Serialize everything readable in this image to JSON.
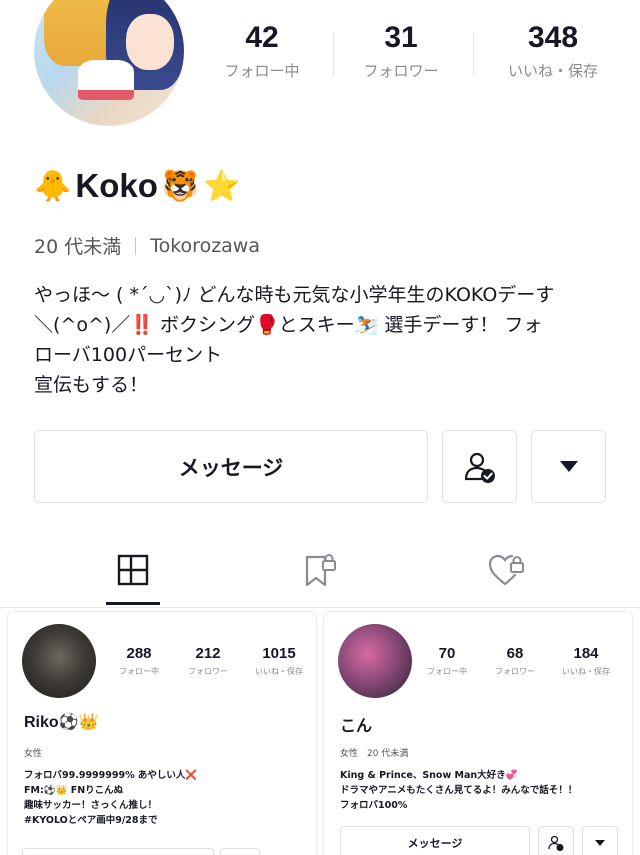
{
  "profile": {
    "avatar_icon": "profile-avatar-anime-artwork",
    "name": "Koko",
    "name_emoji_before": "🐥",
    "name_emoji_after_1": "🐯",
    "name_emoji_after_2": "⭐",
    "age": "20 代未満",
    "location": "Tokorozawa",
    "bio": [
      "やっほ〜 ( *´◡`)ﾉ どんな時も元気な小学年生のKOKOデーす",
      "＼(^o^)／‼️ ボクシング🥊とスキー⛷️ 選手デーす！ フォ",
      "ローバ100パーセント",
      "宣伝もする！"
    ]
  },
  "stats": [
    {
      "value": "42",
      "label": "フォロー中"
    },
    {
      "value": "31",
      "label": "フォロワー"
    },
    {
      "value": "348",
      "label": "いいね・保存"
    }
  ],
  "actions": {
    "message_label": "メッセージ",
    "follow_icon": "person-check-icon",
    "more_icon": "dropdown-triangle-icon"
  },
  "tabs": [
    {
      "icon": "grid-icon",
      "active": true
    },
    {
      "icon": "bookmark-lock-icon",
      "active": false
    },
    {
      "icon": "heart-lock-icon",
      "active": false
    }
  ],
  "suggestions": [
    {
      "name": "Riko⚽️👑",
      "stats": [
        {
          "value": "288",
          "label": "フォロー中"
        },
        {
          "value": "212",
          "label": "フォロワー"
        },
        {
          "value": "1015",
          "label": "いいね・保存"
        }
      ],
      "meta": "女性",
      "bio": [
        "フォロバ99.9999999% あやしい人❌",
        "FM:⚽️👑      FNりこんぬ",
        "趣味サッカー！さっくん推し！",
        "#KYOLOとペア画中9/28まで"
      ]
    },
    {
      "name": "こん",
      "stats": [
        {
          "value": "70",
          "label": "フォロー中"
        },
        {
          "value": "68",
          "label": "フォロワー"
        },
        {
          "value": "184",
          "label": "いいね・保存"
        }
      ],
      "meta": "女性　20 代未満",
      "bio": [
        "King & Prince、Snow Man大好き💞",
        "ドラマやアニメもたくさん見てるよ！みんなで話そ！！",
        "フォロバ100%"
      ],
      "message_label": "メッセージ"
    }
  ],
  "colors": {
    "text": "#161823",
    "muted": "#8a8b91",
    "border": "#dfe0e2"
  }
}
